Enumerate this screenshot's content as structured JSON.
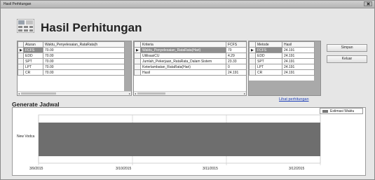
{
  "window": {
    "title": "Hasil Perhitungan"
  },
  "header": {
    "title": "Hasil Perhitungan",
    "icon": "calculator-grid-icon"
  },
  "table_aturan": {
    "columns": [
      "Aturan",
      "Waktu_Penyelesaian_RataRata(h"
    ],
    "rows": [
      [
        "FCFS",
        "70.00"
      ],
      [
        "EDD",
        "70.00"
      ],
      [
        "SPT",
        "70.00"
      ],
      [
        "LPT",
        "70.00"
      ],
      [
        "CR",
        "70.00"
      ]
    ],
    "selected_row": 0
  },
  "table_kriteria": {
    "columns": [
      "Kriteria",
      "FCFS"
    ],
    "rows": [
      [
        "Waktu_Penyelesaian_RataRata(Hari)",
        "70"
      ],
      [
        "UtilisasiCU",
        "4.29"
      ],
      [
        "Jumlah_Pekerjaan_RataRata_Dalam Sistem",
        "23.33"
      ],
      [
        "Keterlambatan_RataRata(Hari)",
        "0"
      ],
      [
        "Hasil",
        "24.191"
      ]
    ],
    "selected_row": 0
  },
  "table_metode": {
    "columns": [
      "Metode",
      "Hasil"
    ],
    "rows": [
      [
        "FCFS",
        "24.191"
      ],
      [
        "EDD",
        "24.191"
      ],
      [
        "SPT",
        "24.191"
      ],
      [
        "LPT",
        "24.191"
      ],
      [
        "CR",
        "24.191"
      ]
    ],
    "selected_row": 0
  },
  "buttons": {
    "save_label": "Simpan",
    "exit_label": "Keluar"
  },
  "link": {
    "label": "Lihat perhitungan"
  },
  "section": {
    "title": "Generate Jadwal"
  },
  "chart_data": {
    "type": "bar",
    "orientation": "horizontal",
    "categories": [
      "New Vodca"
    ],
    "series": [
      {
        "name": "Estimasi Waktu",
        "start": "3/9/2015",
        "end": "3/12/2015",
        "color": "#6e6e6e"
      }
    ],
    "x_ticks": [
      "3/9/2015",
      "3/10/2015",
      "3/11/2015",
      "3/12/2015"
    ],
    "legend": "top-right",
    "grid": true
  }
}
